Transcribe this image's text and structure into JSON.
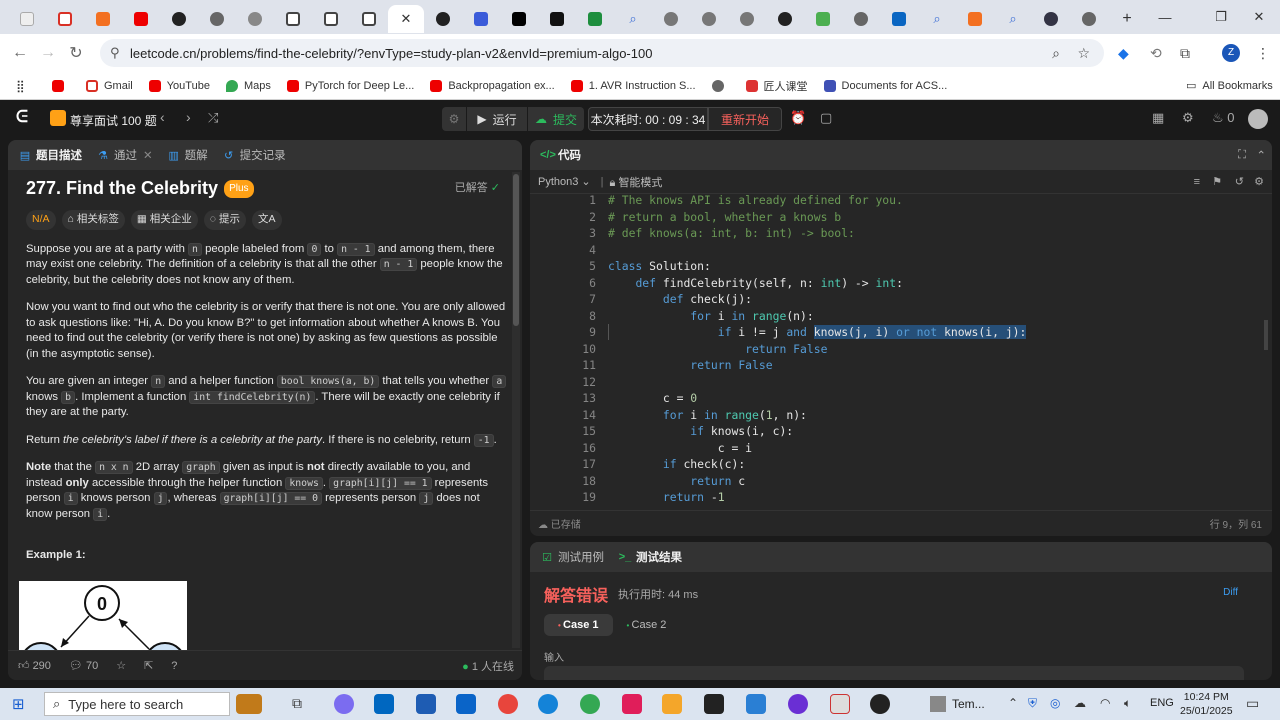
{
  "browser": {
    "url": "leetcode.cn/problems/find-the-celebrity/?envType=study-plan-v2&envId=premium-algo-100",
    "bookmarks": [
      "Gmail",
      "YouTube",
      "Maps",
      "PyTorch for Deep Le...",
      "Backpropagation ex...",
      "1. AVR Instruction S...",
      "匠人课堂",
      "Documents for ACS..."
    ],
    "all_bookmarks": "All Bookmarks",
    "profile_letter": "Z"
  },
  "header": {
    "study_plan": "尊享面试 100 题",
    "run_label": "运行",
    "submit_label": "提交",
    "timer": "本次耗时: 00 : 09 : 34",
    "restart": "重新开始",
    "fire_count": "0"
  },
  "left_panel": {
    "tabs": [
      "题目描述",
      "通过",
      "题解",
      "提交记录"
    ],
    "title": "277. Find the Celebrity",
    "plus_badge": "Plus",
    "solved": "已解答",
    "tags": [
      "N/A",
      "相关标签",
      "相关企业",
      "提示",
      "文A"
    ],
    "p1": {
      "a": "Suppose you are at a party with ",
      "n1": "n",
      "b": " people labeled from ",
      "z": "0",
      "c": " to ",
      "n2": "n - 1",
      "d": " and among them, there may exist one celebrity. The definition of a celebrity is that all the other ",
      "n3": "n - 1",
      "e": " people know the celebrity, but the celebrity does not know any of them."
    },
    "p2": "Now you want to find out who the celebrity is or verify that there is not one. You are only allowed to ask questions like: \"Hi, A. Do you know B?\" to get information about whether A knows B. You need to find out the celebrity (or verify there is not one) by asking as few questions as possible (in the asymptotic sense).",
    "p3": {
      "a": "You are given an integer ",
      "n": "n",
      "b": " and a helper function ",
      "f": "bool knows(a, b)",
      "c": " that tells you whether ",
      "x": "a",
      "d": " knows ",
      "y": "b",
      "e": ". Implement a function ",
      "g": "int findCelebrity(n)",
      "h": ". There will be exactly one celebrity if they are at the party."
    },
    "p4": {
      "a": "Return ",
      "i": "the celebrity's label if there is a celebrity at the party",
      "b": ". If there is no celebrity, return ",
      "v": "-1",
      "c": "."
    },
    "p5": {
      "note": "Note",
      "a": " that the ",
      "arr": "n x n",
      "b": " 2D array ",
      "g": "graph",
      "c": " given as input is ",
      "not": "not",
      "d": " directly available to you, and instead ",
      "only": "only",
      "e": " accessible through the helper function ",
      "k": "knows",
      "f": ". ",
      "g1": "graph[i][j] == 1",
      "h": " represents person ",
      "i": "i",
      "j": " knows person ",
      "jj": "j",
      "k2": ", whereas ",
      "g0": "graph[i][j] == 0",
      "l": " represents person ",
      "j2": "j",
      "m": " does not know person ",
      "i2": "i",
      "end": "."
    },
    "example_heading": "Example 1:",
    "example_node": "0",
    "likes": "290",
    "comments": "70",
    "online": "1 人在线"
  },
  "code_panel": {
    "tab": "代码",
    "language": "Python3",
    "mode": "智能模式",
    "saved": "已存储",
    "cursor": "行 9，列 61",
    "lines": [
      {
        "n": "1",
        "t": "# The knows API is already defined for you."
      },
      {
        "n": "2",
        "t": "# return a bool, whether a knows b"
      },
      {
        "n": "3",
        "t": "# def knows(a: int, b: int) -> bool:"
      },
      {
        "n": "4",
        "t": ""
      },
      {
        "n": "5",
        "t": "class Solution:"
      },
      {
        "n": "6",
        "t": "    def findCelebrity(self, n: int) -> int:"
      },
      {
        "n": "7",
        "t": "        def check(j):"
      },
      {
        "n": "8",
        "t": "            for i in range(n):"
      },
      {
        "n": "9",
        "t": "                if i != j and knows(j, i) or not knows(i, j):"
      },
      {
        "n": "10",
        "t": "                    return False"
      },
      {
        "n": "11",
        "t": "            return False"
      },
      {
        "n": "12",
        "t": ""
      },
      {
        "n": "13",
        "t": "        c = 0"
      },
      {
        "n": "14",
        "t": "        for i in range(1, n):"
      },
      {
        "n": "15",
        "t": "            if knows(i, c):"
      },
      {
        "n": "16",
        "t": "                c = i"
      },
      {
        "n": "17",
        "t": "        if check(c):"
      },
      {
        "n": "18",
        "t": "            return c"
      },
      {
        "n": "19",
        "t": "        return -1"
      }
    ]
  },
  "result_panel": {
    "tabs": [
      "测试用例",
      "测试结果"
    ],
    "status": "解答错误",
    "runtime": "执行用时: 44 ms",
    "diff": "Diff",
    "cases": [
      "Case 1",
      "Case 2"
    ],
    "input_label": "输入"
  },
  "taskbar": {
    "search_placeholder": "Type here to search",
    "app_label": "Tem...",
    "lang": "ENG",
    "time": "10:24 PM",
    "date": "25/01/2025"
  },
  "colors": {
    "accent_orange": "#ffa116",
    "green": "#2cbb5d",
    "error": "#f8615c",
    "link_blue": "#3c9df2"
  }
}
